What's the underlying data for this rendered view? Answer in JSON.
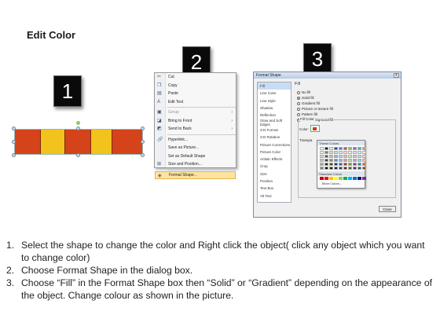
{
  "title": "Edit Color",
  "badges": [
    "1",
    "2",
    "3"
  ],
  "shape": {
    "segments": [
      {
        "color": "#d4431a",
        "flex": 1
      },
      {
        "color": "#f2c21d",
        "flex": 0.95
      },
      {
        "color": "#d4431a",
        "flex": 1
      },
      {
        "color": "#f2c21d",
        "flex": 0.82
      },
      {
        "color": "#d4431a",
        "flex": 1.2
      }
    ]
  },
  "context_menu": {
    "items": [
      {
        "icon": "scissors-icon",
        "glyph": "✂",
        "label": "Cut",
        "disabled": false
      },
      {
        "icon": "copy-icon",
        "glyph": "❐",
        "label": "Copy",
        "disabled": false
      },
      {
        "icon": "paste-icon",
        "glyph": "▤",
        "label": "Paste",
        "disabled": false
      },
      {
        "icon": "edit-text-icon",
        "glyph": "A",
        "label": "Edit Text",
        "disabled": false
      },
      {
        "icon": "group-icon",
        "glyph": "▣",
        "label": "Group",
        "disabled": true,
        "arrow": true
      },
      {
        "icon": "bring-front-icon",
        "glyph": "◪",
        "label": "Bring to Front",
        "disabled": false,
        "arrow": true
      },
      {
        "icon": "send-back-icon",
        "glyph": "◩",
        "label": "Send to Back",
        "disabled": false,
        "arrow": true
      },
      {
        "icon": "hyperlink-icon",
        "glyph": "🔗",
        "label": "Hyperlink...",
        "disabled": false
      },
      {
        "icon": "save-picture-icon",
        "glyph": "",
        "label": "Save as Picture...",
        "disabled": false
      },
      {
        "icon": "default-shape-icon",
        "glyph": "",
        "label": "Set as Default Shape",
        "disabled": false
      },
      {
        "icon": "size-position-icon",
        "glyph": "⊞",
        "label": "Size and Position...",
        "disabled": false
      },
      {
        "icon": "format-shape-icon",
        "glyph": "◈",
        "label": "Format Shape...",
        "disabled": false,
        "highlight": true
      }
    ]
  },
  "dialog": {
    "title": "Format Shape",
    "close_glyph": "x",
    "nav": [
      "Fill",
      "Line Color",
      "Line Style",
      "Shadow",
      "Reflection",
      "Glow and Soft Edges",
      "3-D Format",
      "3-D Rotation",
      "Picture Corrections",
      "Picture Color",
      "Artistic Effects",
      "Crop",
      "Size",
      "Position",
      "Text Box",
      "Alt Text"
    ],
    "panel_heading": "Fill",
    "options": [
      {
        "label": "No fill",
        "selected": false
      },
      {
        "label": "Solid fill",
        "selected": true
      },
      {
        "label": "Gradient fill",
        "selected": false
      },
      {
        "label": "Picture or texture fill",
        "selected": false
      },
      {
        "label": "Pattern fill",
        "selected": false
      },
      {
        "label": "Slide background fill",
        "selected": false
      }
    ],
    "fill_color_heading": "Fill Color",
    "color_label": "Color:",
    "transparency_label": "Transpa",
    "close_button": "Close"
  },
  "palette": {
    "theme_heading": "Theme Colors",
    "standard_heading": "Standard Colors",
    "more_colors": "More Colors...",
    "theme_top": [
      "#ffffff",
      "#000000",
      "#eeece1",
      "#1f497d",
      "#4f81bd",
      "#c0504d",
      "#9bbb59",
      "#8064a2",
      "#4bacc6",
      "#f79646"
    ],
    "theme_shades": [
      [
        "#f2f2f2",
        "#7f7f7f",
        "#ddd9c3",
        "#c6d9f0",
        "#dbe5f1",
        "#f2dcdb",
        "#ebf1dd",
        "#e5e0ec",
        "#dbeef3",
        "#fdeada"
      ],
      [
        "#d8d8d8",
        "#595959",
        "#c4bd97",
        "#8db3e2",
        "#b8cce4",
        "#e5b9b7",
        "#d7e3bc",
        "#ccc1d9",
        "#b7dde8",
        "#fbd5b5"
      ],
      [
        "#bfbfbf",
        "#3f3f3f",
        "#938953",
        "#548dd4",
        "#95b3d7",
        "#d99694",
        "#c3d69b",
        "#b2a2c7",
        "#92cddc",
        "#fac08f"
      ],
      [
        "#a5a5a5",
        "#262626",
        "#494429",
        "#17365d",
        "#366092",
        "#953734",
        "#76923c",
        "#5f497a",
        "#31859b",
        "#e36c09"
      ],
      [
        "#7f7f7f",
        "#0c0c0c",
        "#1d1b10",
        "#0f243e",
        "#244061",
        "#632423",
        "#4f6128",
        "#3f3151",
        "#205867",
        "#974806"
      ]
    ],
    "standard": [
      "#c00000",
      "#ff0000",
      "#ffc000",
      "#ffff00",
      "#92d050",
      "#00b050",
      "#00b0f0",
      "#0070c0",
      "#002060",
      "#7030a0"
    ]
  },
  "steps": [
    {
      "num": "1.",
      "text": "Select the shape to change the color and Right click the object( click any object which you want to change color)"
    },
    {
      "num": "2.",
      "text": "Choose Format Shape in the dialog box."
    },
    {
      "num": "3.",
      "text": "Choose “Fill” in the Format Shape box then “Solid” or “Gradient” depending on the appearance of the object. Change colour as shown in the picture."
    }
  ]
}
